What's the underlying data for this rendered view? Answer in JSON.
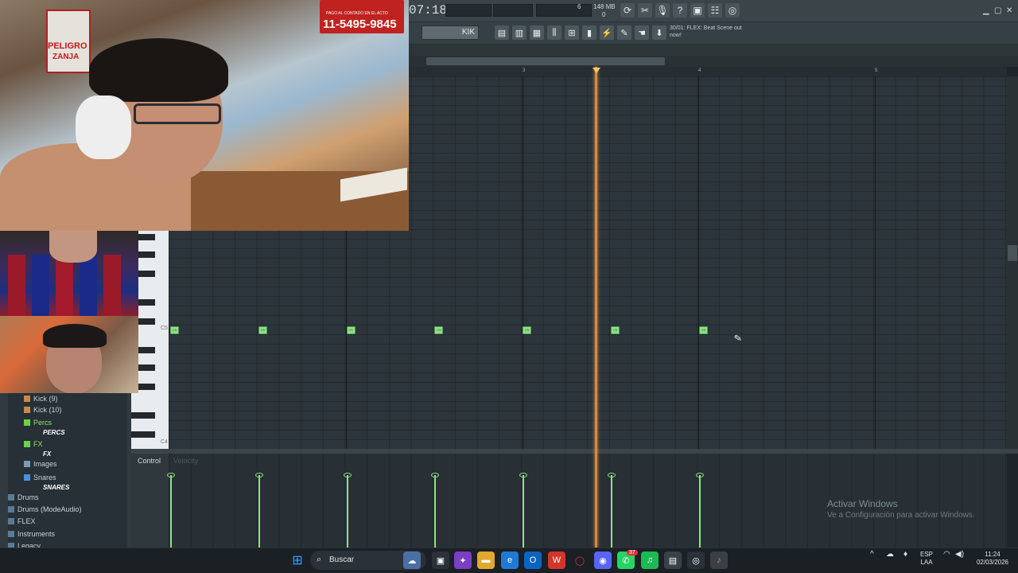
{
  "toolbar": {
    "time": "07:18",
    "memory": "148 MB",
    "cpu_value": "6",
    "mem_sub": "0",
    "pattern_name": "KIK",
    "news_line1": "30/01: FLEX: Beat Scene out",
    "news_line2": "now!"
  },
  "ruler": {
    "labels": [
      "3",
      "4",
      "5"
    ]
  },
  "piano_roll": {
    "key_label_c5": "C5",
    "key_label_c4": "C4",
    "note_label": "C5",
    "notes": [
      {
        "name": "C5",
        "beat": 0
      },
      {
        "name": "C5",
        "beat": 1
      },
      {
        "name": "C5",
        "beat": 2
      },
      {
        "name": "C5",
        "beat": 3
      },
      {
        "name": "C5",
        "beat": 4
      },
      {
        "name": "C5",
        "beat": 5
      },
      {
        "name": "C5",
        "beat": 6
      }
    ]
  },
  "control_lane": {
    "label": "Control",
    "sublabel": "Velocity"
  },
  "webcam": {
    "sign_text": "PELIGRO",
    "sign_text2": "ZANJA",
    "ad_phone": "11-5495-9845",
    "ad_small": "PAGO AL CONTADO EN EL ACTO"
  },
  "browser": {
    "items": [
      {
        "label": "Kick (9)",
        "type": "file"
      },
      {
        "label": "Kick (10)",
        "type": "file"
      },
      {
        "label": "Percs",
        "type": "folder-active"
      },
      {
        "label": "PERCS",
        "type": "bold"
      },
      {
        "label": "FX",
        "type": "folder-active"
      },
      {
        "label": "FX",
        "type": "bold"
      },
      {
        "label": "Images",
        "type": "folder"
      },
      {
        "label": "Snares",
        "type": "folder-blue"
      },
      {
        "label": "SNARES",
        "type": "bold"
      },
      {
        "label": "Drums",
        "type": "root"
      },
      {
        "label": "Drums (ModeAudio)",
        "type": "root"
      },
      {
        "label": "FLEX",
        "type": "root"
      },
      {
        "label": "Instruments",
        "type": "root"
      },
      {
        "label": "Legacy",
        "type": "root"
      }
    ]
  },
  "watermark": {
    "title": "Activar Windows",
    "subtitle": "Ve a Configuración para activar Windows."
  },
  "taskbar": {
    "search_placeholder": "Buscar",
    "lang": "ESP",
    "lang_sub": "LAA",
    "clock_time": "11:24",
    "clock_date": "02/03/2026",
    "badge_whatsapp": "37"
  },
  "colors": {
    "note": "#8fe08a",
    "playhead": "#d78a3c",
    "grid": "#2c353b"
  }
}
